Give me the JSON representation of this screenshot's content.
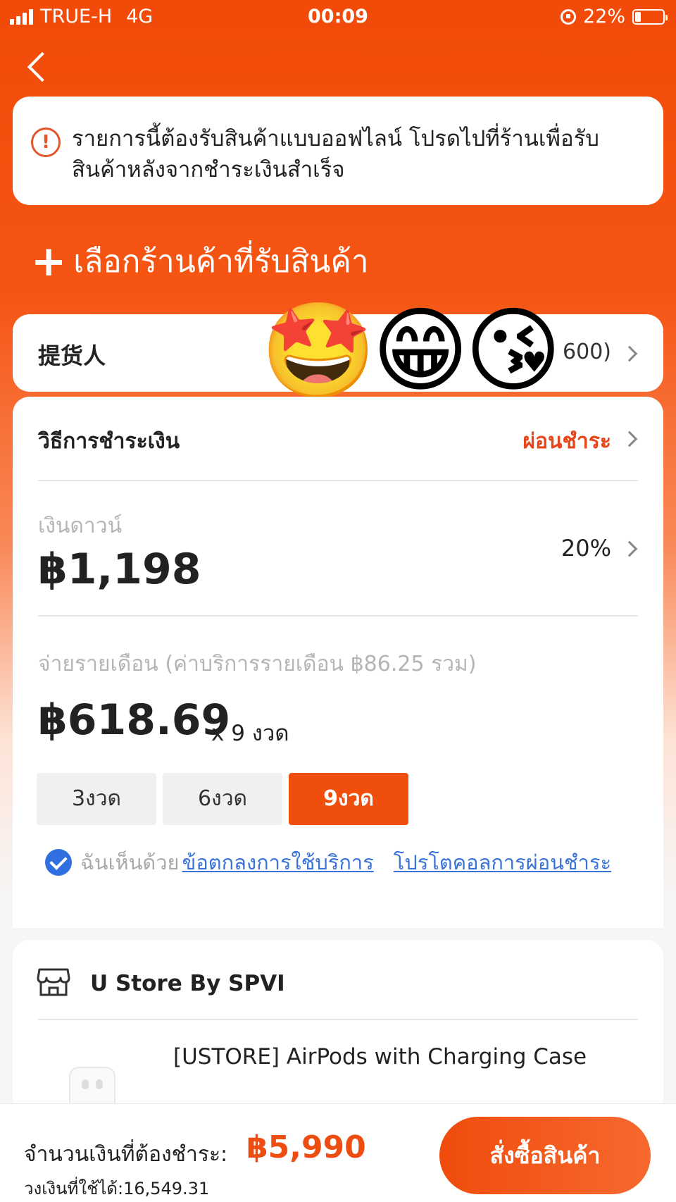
{
  "status_bar": {
    "carrier": "TRUE-H",
    "network": "4G",
    "time": "00:09",
    "battery": "22%",
    "battery_level": 0.22
  },
  "header": {
    "back_icon": "chevron-left-icon"
  },
  "notice": {
    "icon": "alert-circle-icon",
    "text": "รายการนี้ต้องรับสินค้าแบบออฟไลน์ โปรดไปที่ร้านเพื่อรับสินค้าหลังจากชำระเงินสำเร็จ"
  },
  "pickup": {
    "icon": "plus-icon",
    "label": "เลือกร้านค้าที่รับสินค้า"
  },
  "receiver": {
    "label": "提货人",
    "value": "600)",
    "emojis": "🤩😁😘"
  },
  "payment": {
    "method_label": "วิธีการชำระเงิน",
    "method_value": "ผ่อนชำระ",
    "down_payment_label": "เงินดาวน์",
    "down_payment_amount": "฿1,198",
    "down_payment_percent": "20%",
    "monthly_label": "จ่ายรายเดือน (ค่าบริการรายเดือน ฿86.25 รวม)",
    "monthly_amount": "฿618.69",
    "monthly_times": "x 9 งวด",
    "installments": [
      "3งวด",
      "6งวด",
      "9งวด"
    ],
    "selected_installment": "9งวด",
    "agree_text": "ฉันเห็นด้วย",
    "terms_link": "ข้อตกลงการใช้บริการ",
    "protocol_link": "โปรโตคอลการผ่อนชำระ"
  },
  "store": {
    "icon": "store-icon",
    "name": "U Store By SPVI",
    "product_name": "[USTORE] AirPods with Charging Case"
  },
  "footer": {
    "total_label": "จำนวนเงินที่ต้องชำระ:",
    "total_value": "฿5,990",
    "credit_label": "วงเงินที่ใช้ได้:16,549.31",
    "order_button": "สั่งซื้อสินค้า"
  },
  "colors": {
    "brand": "#ef4e0c",
    "link": "#3a73d8",
    "check": "#2f6fe0"
  }
}
